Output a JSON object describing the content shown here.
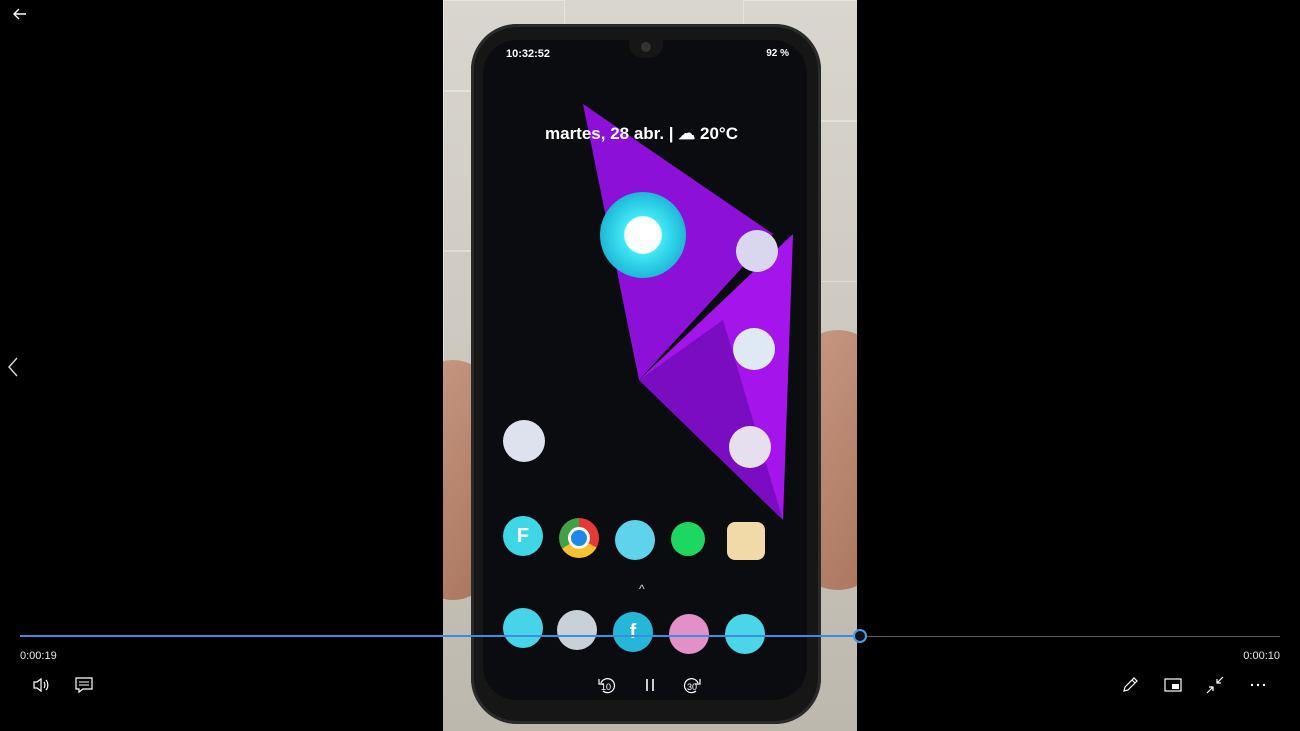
{
  "player": {
    "elapsed": "0:00:19",
    "remaining": "0:00:10",
    "progress_fraction": 0.667,
    "accent_color": "#3b8de0",
    "skip_back_seconds": "10",
    "skip_forward_seconds": "30",
    "icons": {
      "back": "back-arrow-icon",
      "previous": "chevron-left-icon",
      "volume": "volume-icon",
      "captions": "captions-icon",
      "rewind": "rewind-10-icon",
      "pause": "pause-icon",
      "forward": "forward-30-icon",
      "edit": "pencil-icon",
      "miniview": "mini-view-icon",
      "exit_fullscreen": "exit-fullscreen-icon",
      "more": "more-icon"
    }
  },
  "video_frame": {
    "phone_status_time": "10:32:52",
    "phone_battery": "92 %",
    "phone_date_weather": "martes, 28 abr. | ☁ 20°C",
    "wallpaper_accent": "#a20fe0"
  }
}
